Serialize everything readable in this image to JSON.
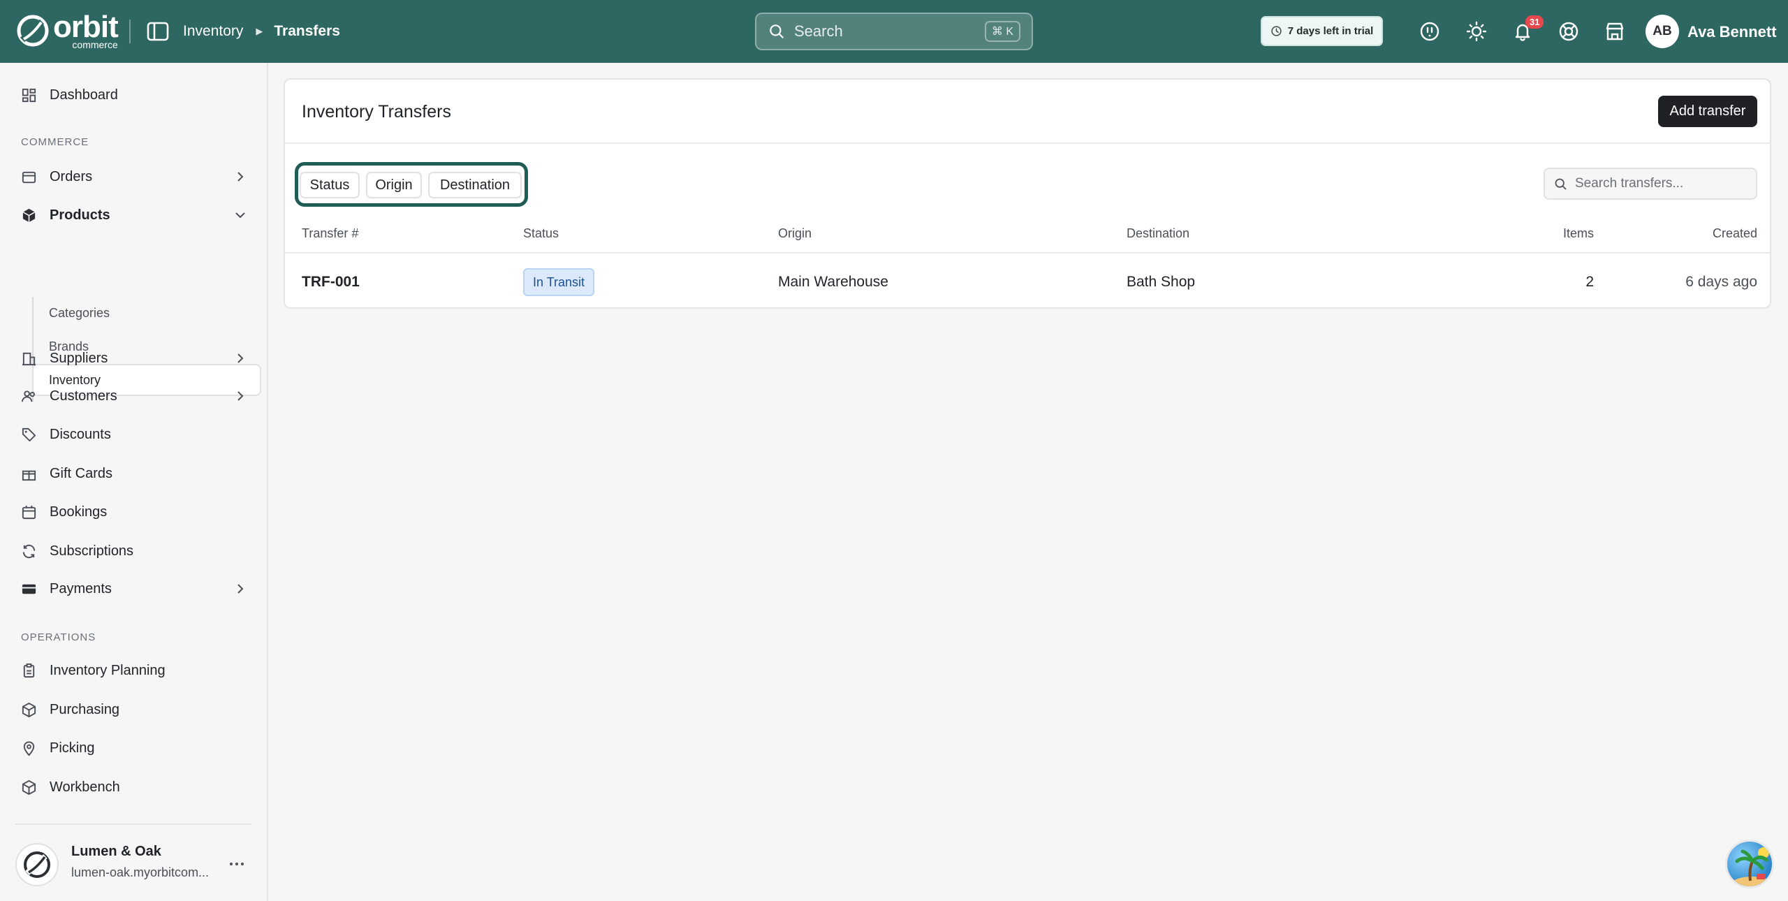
{
  "topbar": {
    "logo_text": "orbit",
    "logo_subtext": "commerce",
    "breadcrumb": {
      "parent": "Inventory",
      "current": "Transfers"
    },
    "search": {
      "placeholder": "Search",
      "shortcut": "⌘ K"
    },
    "trial_text": "7 days left in trial",
    "notification_count": "31",
    "user": {
      "initials": "AB",
      "name": "Ava Bennett"
    },
    "colors": {
      "background": "#2e6761"
    }
  },
  "sidebar": {
    "dashboard": "Dashboard",
    "commerce_label": "COMMERCE",
    "orders": "Orders",
    "products": "Products",
    "product_sub": [
      "Categories",
      "Brands",
      "Inventory"
    ],
    "suppliers": "Suppliers",
    "customers": "Customers",
    "discounts": "Discounts",
    "gift_cards": "Gift Cards",
    "bookings": "Bookings",
    "subscriptions": "Subscriptions",
    "payments": "Payments",
    "operations_label": "OPERATIONS",
    "inventory_planning": "Inventory Planning",
    "purchasing": "Purchasing",
    "picking": "Picking",
    "workbench": "Workbench",
    "store": {
      "name": "Lumen & Oak",
      "url": "lumen-oak.myorbitcom..."
    }
  },
  "main": {
    "title": "Inventory Transfers",
    "add_button": "Add transfer",
    "filters": [
      "Status",
      "Origin",
      "Destination"
    ],
    "search_placeholder": "Search transfers...",
    "columns": [
      "Transfer #",
      "Status",
      "Origin",
      "Destination",
      "Items",
      "Created"
    ],
    "rows": [
      {
        "id": "TRF-001",
        "status": "In Transit",
        "origin": "Main Warehouse",
        "destination": "Bath Shop",
        "items": "2",
        "created": "6 days ago"
      }
    ],
    "colors": {
      "status_in_transit": "#dbe9fb",
      "filter_focus": "#1f5c55",
      "primary_button": "#1f2124"
    }
  }
}
